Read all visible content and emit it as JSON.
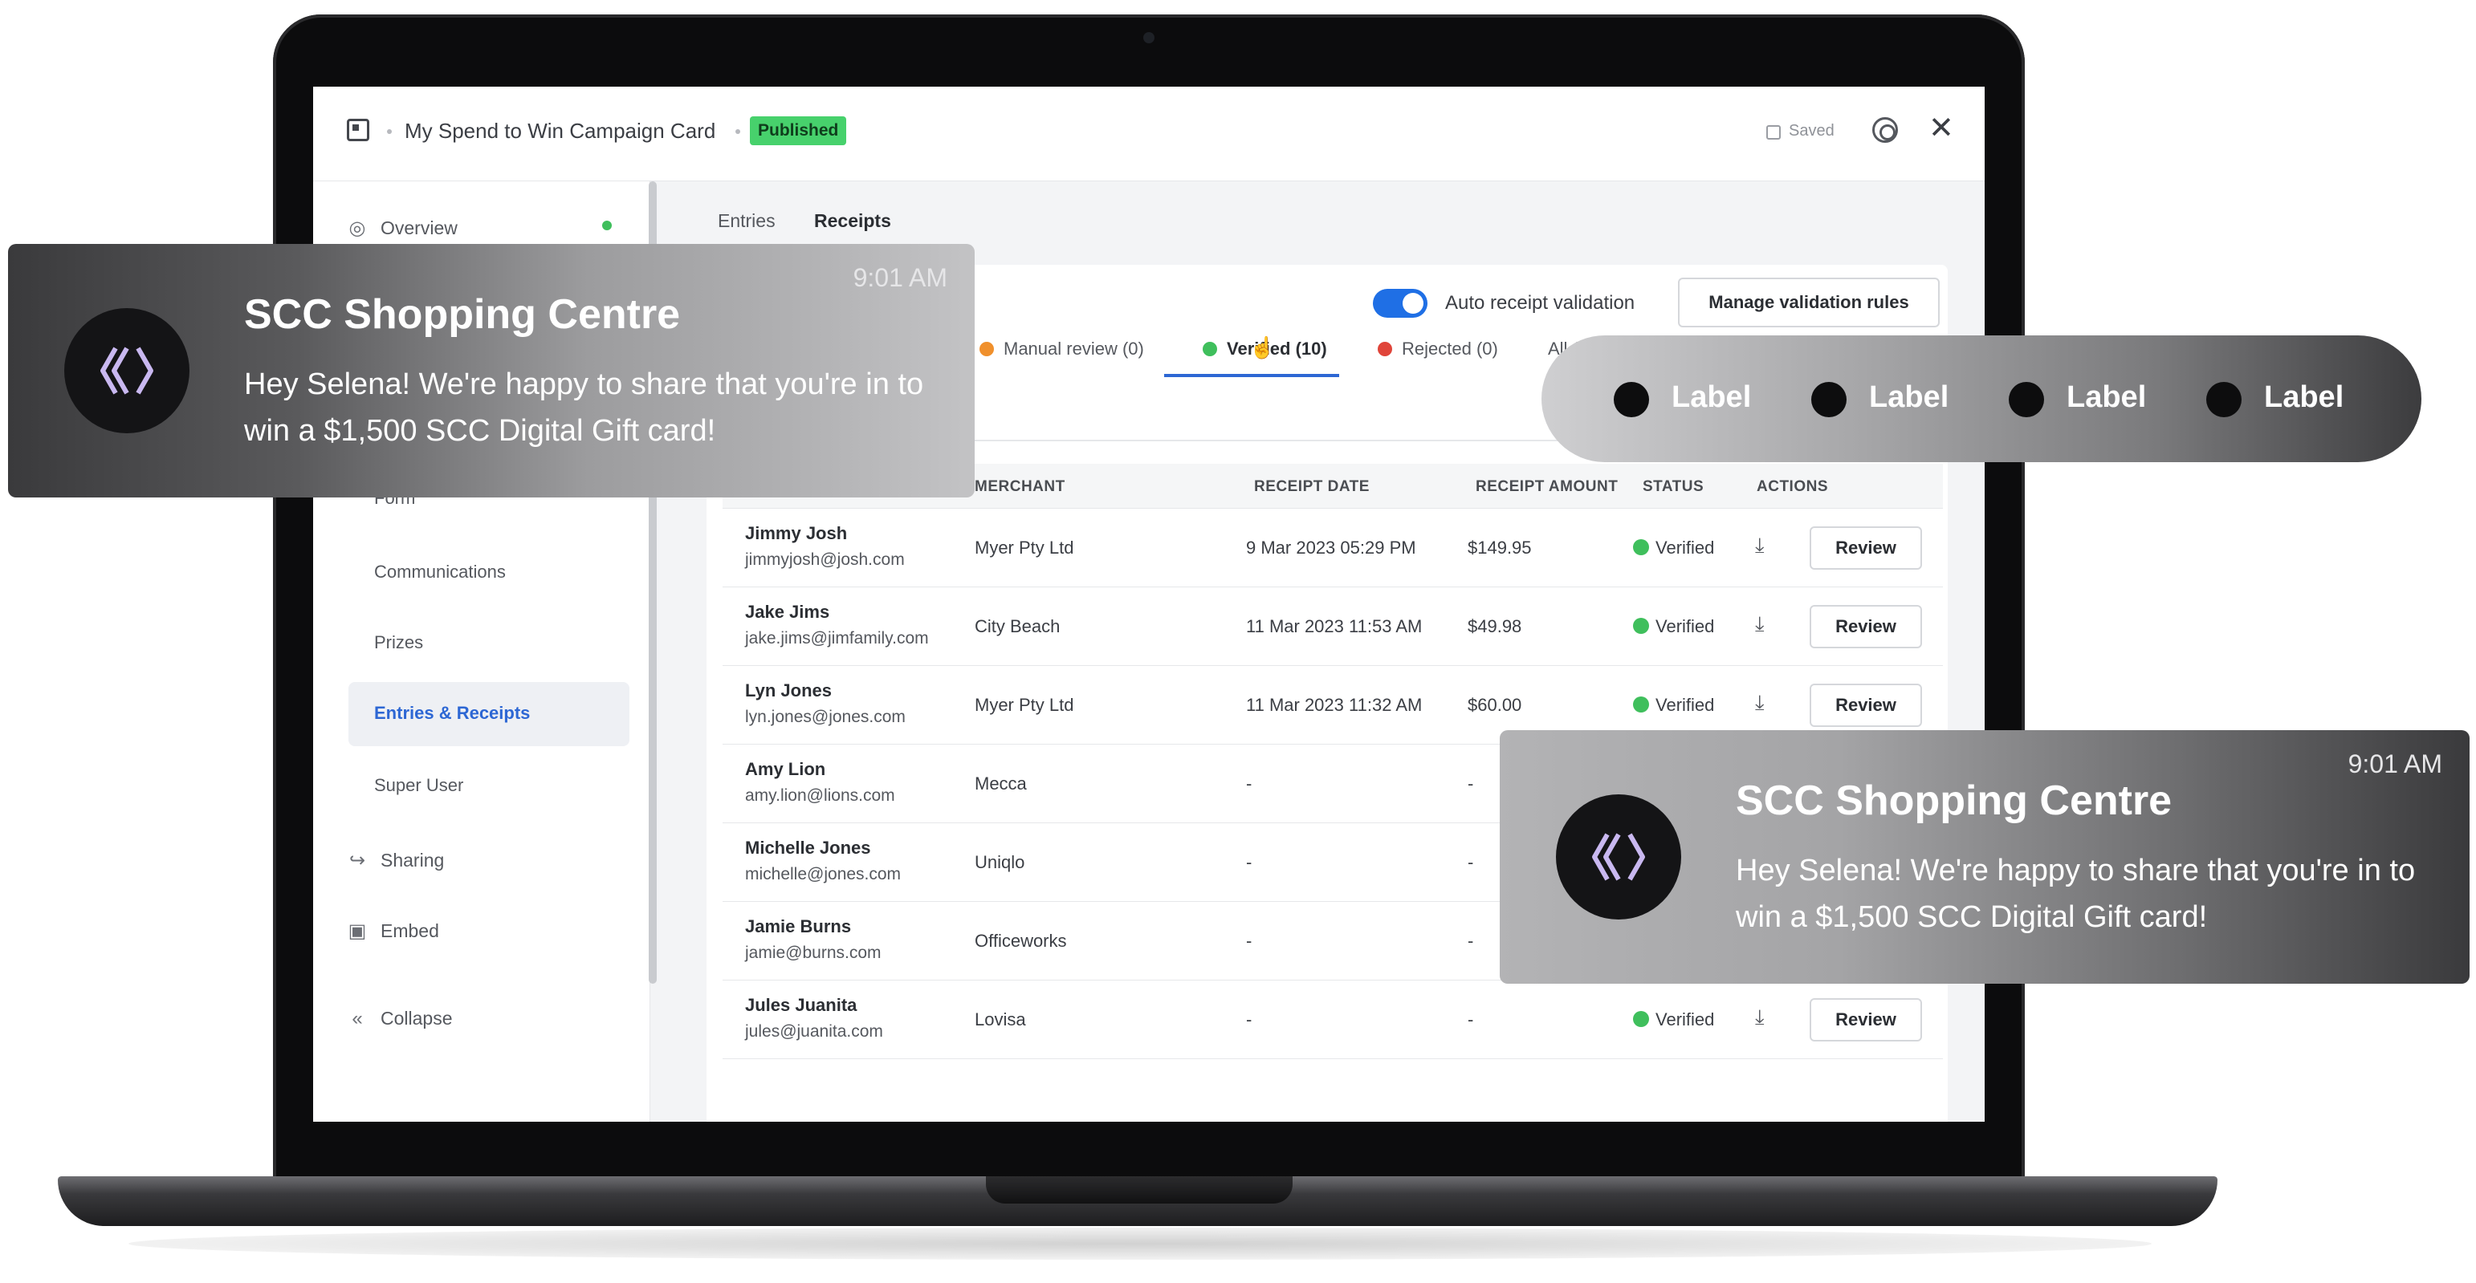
{
  "app": {
    "title": "My Spend to Win Campaign Card",
    "status_badge": "Published",
    "saved_label": "Saved"
  },
  "sidebar": {
    "overview": "Overview",
    "sub_items": [
      "Form",
      "Communications",
      "Prizes",
      "Entries & Receipts",
      "Super User"
    ],
    "active_item": "Entries & Receipts",
    "sharing": "Sharing",
    "embed": "Embed",
    "collapse": "Collapse"
  },
  "content_tabs": [
    "Entries",
    "Receipts"
  ],
  "toolbar": {
    "auto_validation_label": "Auto receipt validation",
    "manage_rules_button": "Manage validation rules"
  },
  "filter_tabs": {
    "manual": "Manual review (0)",
    "verified": "Verified (10)",
    "rejected": "Rejected (0)",
    "all": "All (",
    "colors": {
      "manual": "#f0902c",
      "verified": "#3fbf5c",
      "rejected": "#e0453a"
    }
  },
  "table": {
    "headers": [
      "MERCHANT",
      "RECEIPT DATE",
      "RECEIPT AMOUNT",
      "STATUS",
      "ACTIONS"
    ],
    "rows": [
      {
        "name": "Jimmy Josh",
        "email": "jimmyjosh@josh.com",
        "merchant": "Myer Pty Ltd",
        "date": "9 Mar 2023 05:29 PM",
        "amount": "$149.95",
        "status": "Verified",
        "action": "Review"
      },
      {
        "name": "Jake Jims",
        "email": "jake.jims@jimfamily.com",
        "merchant": "City Beach",
        "date": "11 Mar 2023 11:53 AM",
        "amount": "$49.98",
        "status": "Verified",
        "action": "Review"
      },
      {
        "name": "Lyn Jones",
        "email": "lyn.jones@jones.com",
        "merchant": "Myer Pty Ltd",
        "date": "11 Mar 2023 11:32 AM",
        "amount": "$60.00",
        "status": "Verified",
        "action": "Review"
      },
      {
        "name": "Amy Lion",
        "email": "amy.lion@lions.com",
        "merchant": "Mecca",
        "date": "-",
        "amount": "-",
        "status": "",
        "action": ""
      },
      {
        "name": "Michelle Jones",
        "email": "michelle@jones.com",
        "merchant": "Uniqlo",
        "date": "-",
        "amount": "-",
        "status": "",
        "action": ""
      },
      {
        "name": "Jamie Burns",
        "email": "jamie@burns.com",
        "merchant": "Officeworks",
        "date": "-",
        "amount": "-",
        "status": "",
        "action": ""
      },
      {
        "name": "Jules Juanita",
        "email": "jules@juanita.com",
        "merchant": "Lovisa",
        "date": "-",
        "amount": "-",
        "status": "Verified",
        "action": "Review"
      }
    ]
  },
  "notifications": [
    {
      "title": "SCC Shopping Centre",
      "body": "Hey Selena! We're happy to share that you're in to win a $1,500 SCC Digital Gift card!",
      "time": "9:01 AM"
    },
    {
      "title": "SCC Shopping Centre",
      "body": "Hey Selena! We're happy to share that you're in to win a $1,500 SCC Digital Gift card!",
      "time": "9:01 AM"
    }
  ],
  "labels": [
    "Label",
    "Label",
    "Label",
    "Label"
  ],
  "icons": {
    "sidebar": [
      "target-icon",
      "share-icon",
      "embed-icon",
      "collapse-icon"
    ],
    "download": "download-icon",
    "logo": "scc-logo-icon"
  }
}
